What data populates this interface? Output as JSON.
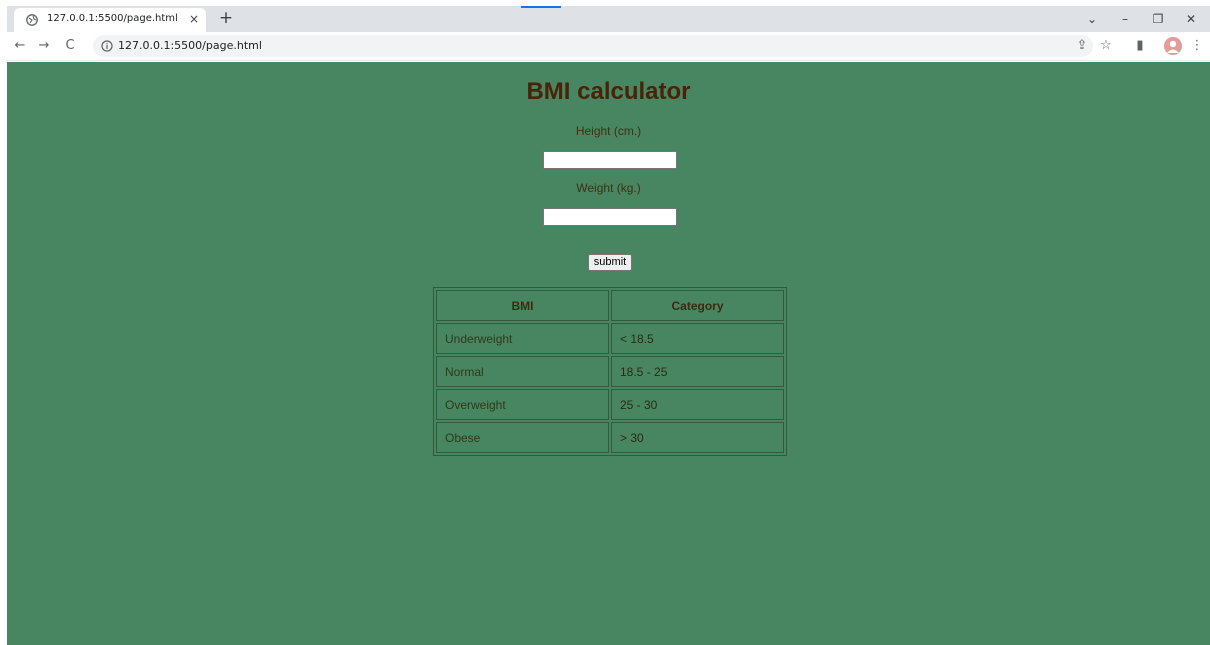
{
  "browser": {
    "tab_title": "127.0.0.1:5500/page.html",
    "tab_close": "×",
    "new_tab": "+",
    "url": "127.0.0.1:5500/page.html",
    "nav": {
      "back": "←",
      "forward": "→",
      "reload": "C"
    },
    "window_controls": {
      "dropdown": "⌄",
      "minimize": "–",
      "restore": "❐",
      "close": "✕"
    },
    "toolbar_icons": {
      "share": "⇪",
      "bookmark": "☆",
      "sidepanel": "▮",
      "menu": "⋮"
    }
  },
  "page": {
    "title": "BMI calculator",
    "height_label": "Height (cm.)",
    "weight_label": "Weight (kg.)",
    "height_value": "",
    "weight_value": "",
    "submit_label": "submit",
    "table": {
      "headers": [
        "BMI",
        "Category"
      ],
      "rows": [
        [
          "Underweight",
          "< 18.5"
        ],
        [
          "Normal",
          "18.5 - 25"
        ],
        [
          "Overweight",
          "25 - 30"
        ],
        [
          "Obese",
          "> 30"
        ]
      ]
    }
  },
  "colors": {
    "page_background": "#478660",
    "title_color": "#4a2208",
    "table_border": "#2f5c3a"
  }
}
